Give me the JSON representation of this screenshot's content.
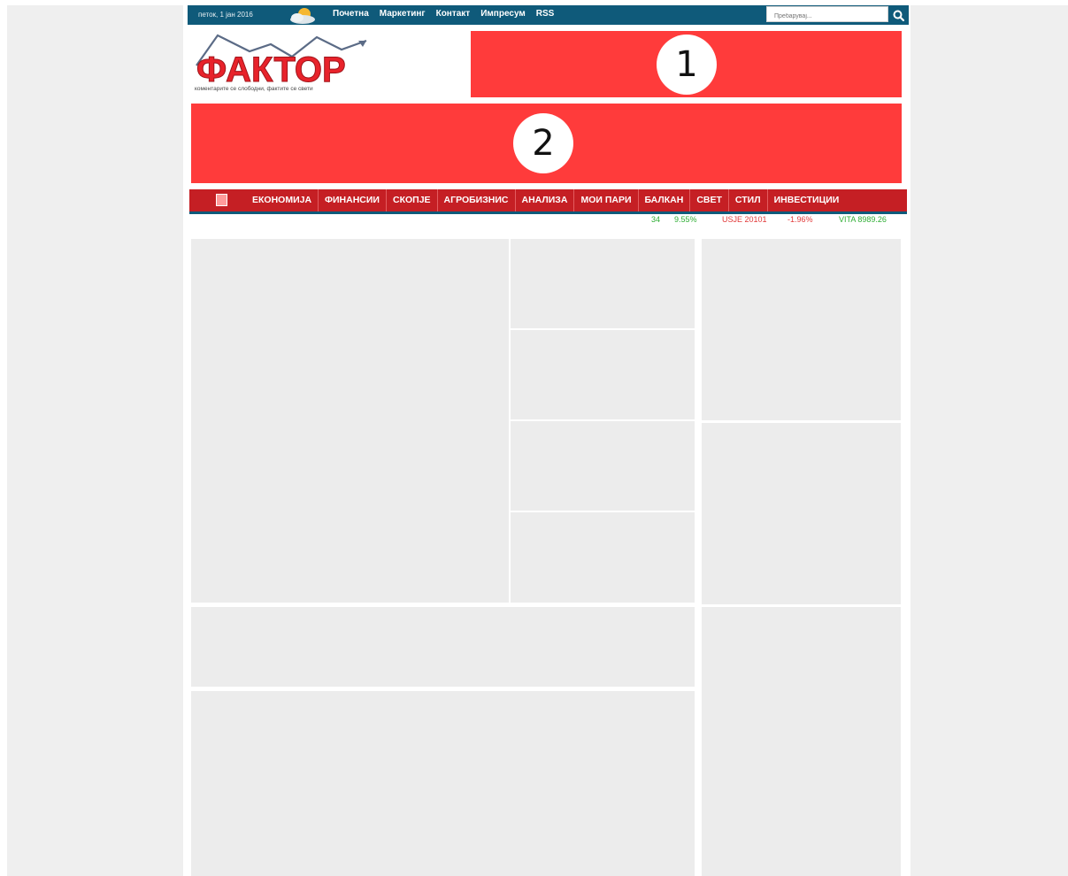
{
  "topbar": {
    "date": "петок, 1 јан 2016",
    "weather_icon": "cloud-sun-icon",
    "nav": [
      "Почетна",
      "Маркетинг",
      "Контакт",
      "Импресум",
      "RSS"
    ],
    "search_placeholder": "Пребарувај...",
    "search_icon": "search-icon"
  },
  "logo": {
    "text": "ФАКТОР",
    "tagline": "коментарите се слободни, фактите се свети"
  },
  "ads": {
    "ad1_label": "1",
    "ad2_label": "2",
    "color": "#ff3b3b"
  },
  "mainnav": {
    "items": [
      "ЕКОНОМИЈА",
      "ФИНАНСИИ",
      "СКОПЈЕ",
      "АГРОБИЗНИС",
      "АНАЛИЗА",
      "МОИ ПАРИ",
      "БАЛКАН",
      "СВЕТ",
      "СТИЛ",
      "ИНВЕСТИЦИИ"
    ]
  },
  "ticker": {
    "items": [
      {
        "text": "34",
        "color": "green"
      },
      {
        "text": "9.55%",
        "color": "green"
      },
      {
        "text": "USJE 20101",
        "color": "red"
      },
      {
        "text": "-1.96%",
        "color": "red"
      },
      {
        "text": "VITA 8989.26",
        "color": "green"
      }
    ]
  },
  "colors": {
    "topbar": "#0f5a7a",
    "nav": "#c51f24",
    "placeholder_block": "#ececec"
  }
}
